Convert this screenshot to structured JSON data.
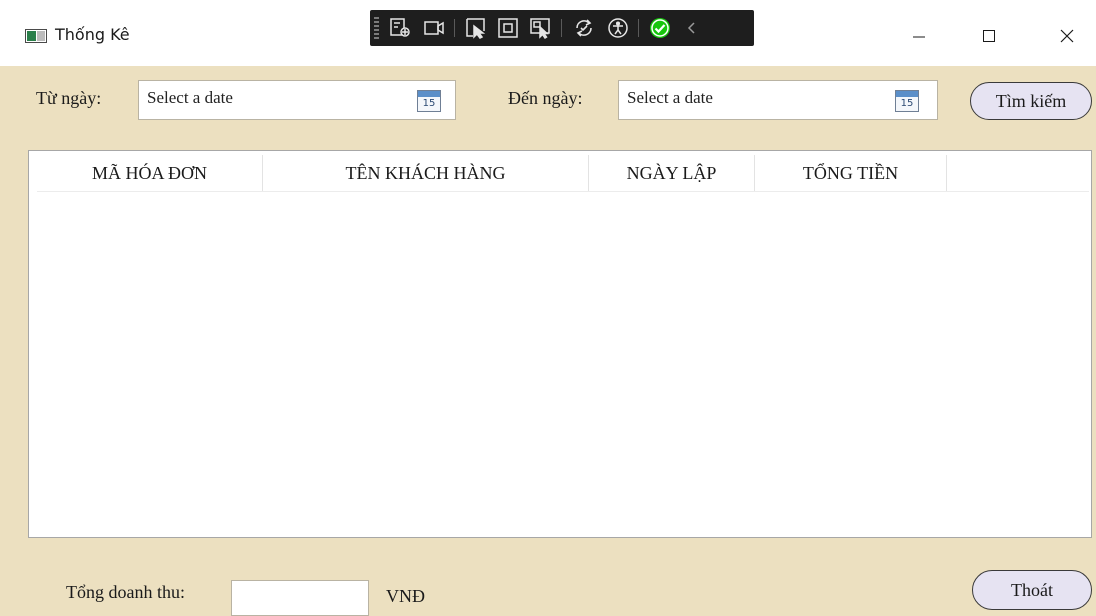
{
  "window": {
    "title": "Thống Kê"
  },
  "devtools": {
    "icons": [
      "live-visual-tree-icon",
      "record-icon",
      "select-element-icon",
      "display-layout-adorners-icon",
      "track-focus-icon",
      "hot-reload-icon",
      "accessibility-checker-icon",
      "binding-ok-icon",
      "collapse-icon"
    ]
  },
  "filters": {
    "from_label": "Từ ngày:",
    "from_placeholder": "Select a date",
    "to_label": "Đến ngày:",
    "to_placeholder": "Select a date",
    "calendar_day": "15",
    "search_button": "Tìm kiếm"
  },
  "table": {
    "columns": [
      "MÃ HÓA ĐƠN",
      "TÊN KHÁCH HÀNG",
      "NGÀY LẬP",
      "TỔNG TIỀN"
    ],
    "rows": []
  },
  "footer": {
    "total_label": "Tổng doanh thu:",
    "total_value": "",
    "currency": "VNĐ",
    "exit_button": "Thoát"
  },
  "colors": {
    "background": "#ece0c0",
    "button_fill": "#e6e3f2"
  }
}
